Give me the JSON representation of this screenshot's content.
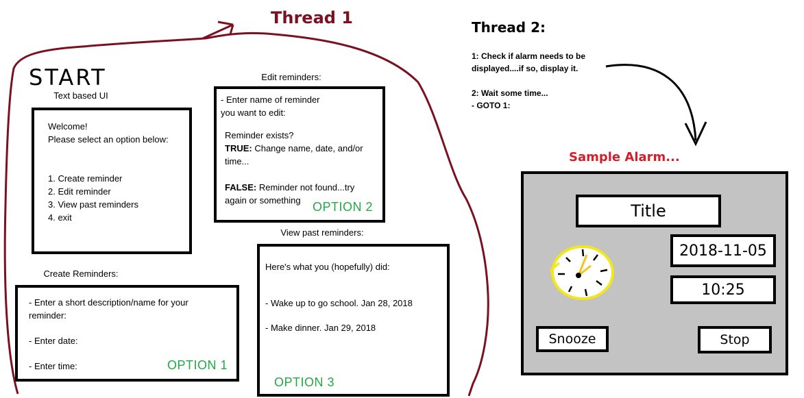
{
  "thread1": {
    "title": "Thread 1"
  },
  "start": {
    "title": "START",
    "subtitle": "Text based UI"
  },
  "welcome_box": {
    "line1": "Welcome!",
    "line2": "Please select an option below:",
    "options": [
      "1. Create reminder",
      "2. Edit reminder",
      "3. View past reminders",
      "4. exit"
    ]
  },
  "edit": {
    "label": "Edit reminders:",
    "line1": "- Enter name of reminder",
    "line2": "you want to edit:",
    "line3": "Reminder exists?",
    "true_label": "TRUE:",
    "true_text": " Change name, date, and/or",
    "true_text2": "time...",
    "false_label": "FALSE:",
    "false_text": " Reminder not found...try",
    "false_text2": "again or something",
    "option": "OPTION 2"
  },
  "create": {
    "label": "Create Reminders:",
    "line1": "- Enter a short description/name for your",
    "line2": "reminder:",
    "line3": "- Enter date:",
    "line4": "- Enter time:",
    "option": "OPTION 1"
  },
  "view": {
    "label": "View past reminders:",
    "line1": "Here's what you (hopefully) did:",
    "line2": "- Wake up to go school. Jan 28, 2018",
    "line3": "- Make dinner. Jan 29, 2018",
    "option": "OPTION 3"
  },
  "thread2": {
    "title": "Thread 2:",
    "step1a": "1:  Check if alarm needs to be",
    "step1b": "displayed....if so, display it.",
    "step2": "2:  Wait some time...",
    "goto": "- GOTO 1:"
  },
  "alarm": {
    "caption": "Sample Alarm...",
    "title": "Title",
    "date": "2018-11-05",
    "time": "10:25",
    "snooze": "Snooze",
    "stop": "Stop"
  },
  "colors": {
    "outline": "#7a1020",
    "option": "#22a845",
    "alarm_caption": "#d2202a",
    "panel": "#c3c3c3",
    "clock": "#f2e61c"
  }
}
